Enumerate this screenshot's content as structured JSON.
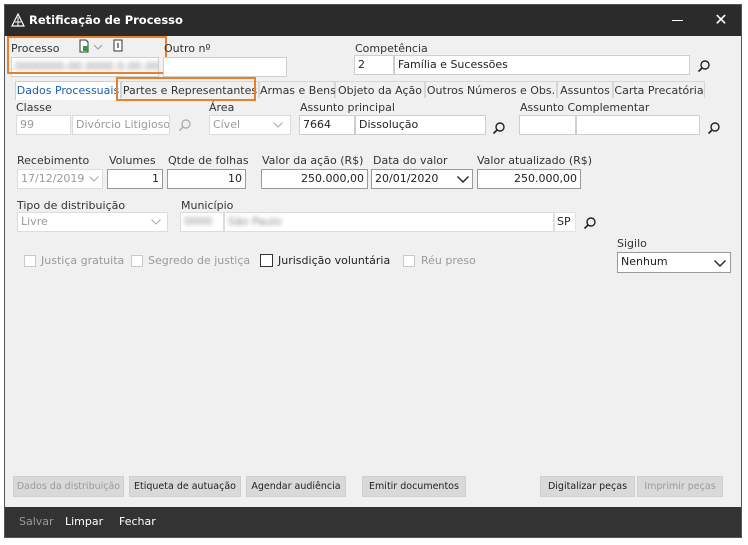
{
  "window": {
    "title": "Retificação de Processo"
  },
  "header": {
    "processo_label": "Processo",
    "processo_value": "0000000-00.0000.0.00.0000",
    "outro_label": "Outro nº",
    "outro_value": "",
    "competencia_label": "Competência",
    "competencia_code": "2",
    "competencia_name": "Família e Sucessões"
  },
  "tabs": [
    {
      "label": "Dados Processuais"
    },
    {
      "label": "Partes e Representantes"
    },
    {
      "label": "Armas e Bens"
    },
    {
      "label": "Objeto da Ação"
    },
    {
      "label": "Outros Números e Obs."
    },
    {
      "label": "Assuntos"
    },
    {
      "label": "Carta Precatória"
    }
  ],
  "form": {
    "classe_label": "Classe",
    "classe_code": "99",
    "classe_name": "Divórcio Litigioso",
    "area_label": "Área",
    "area_value": "Cível",
    "assunto_principal_label": "Assunto principal",
    "assunto_principal_code": "7664",
    "assunto_principal_name": "Dissolução",
    "assunto_complementar_label": "Assunto Complementar",
    "assunto_complementar_code": "",
    "assunto_complementar_name": "",
    "recebimento_label": "Recebimento",
    "recebimento_value": "17/12/2019",
    "volumes_label": "Volumes",
    "volumes_value": "1",
    "qtde_folhas_label": "Qtde de folhas",
    "qtde_folhas_value": "10",
    "valor_acao_label": "Valor da ação (R$)",
    "valor_acao_value": "250.000,00",
    "data_valor_label": "Data do valor",
    "data_valor_value": "20/01/2020",
    "valor_atualizado_label": "Valor atualizado (R$)",
    "valor_atualizado_value": "250.000,00",
    "tipo_distribuicao_label": "Tipo de distribuição",
    "tipo_distribuicao_value": "Livre",
    "municipio_label": "Município",
    "municipio_code": "0000",
    "municipio_name": "São Paulo",
    "municipio_uf": "SP",
    "sigilo_label": "Sigilo",
    "sigilo_value": "Nenhum",
    "checks": {
      "justica_gratuita": "Justiça gratuita",
      "segredo_justica": "Segredo de justiça",
      "jurisdicao_voluntaria": "Jurisdição voluntária",
      "reu_preso": "Réu preso"
    }
  },
  "buttons": {
    "dados_distribuicao": "Dados da distribuição",
    "etiqueta_autuacao": "Etiqueta de autuação",
    "agendar_audiencia": "Agendar audiência",
    "emitir_documentos": "Emitir documentos",
    "digitalizar_pecas": "Digitalizar peças",
    "imprimir_pecas": "Imprimir peças"
  },
  "footer": {
    "salvar": "Salvar",
    "limpar": "Limpar",
    "fechar": "Fechar"
  },
  "colors": {
    "accent_tab": "#1a5fb4",
    "highlight": "#e9802e",
    "titlebar": "#2b2b2b",
    "footer": "#333333"
  }
}
